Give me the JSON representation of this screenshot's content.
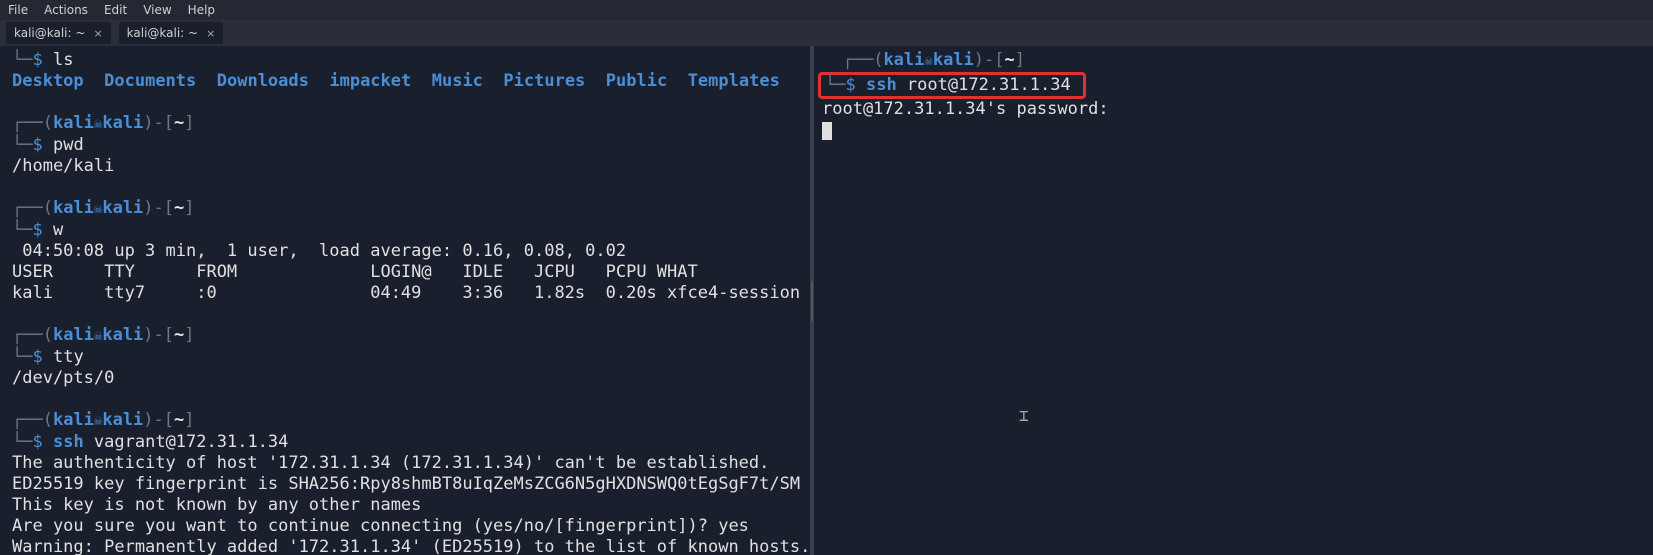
{
  "menubar": {
    "file": "File",
    "actions": "Actions",
    "edit": "Edit",
    "view": "View",
    "help": "Help"
  },
  "tabs": [
    {
      "title": "kali@kali: ~"
    },
    {
      "title": "kali@kali: ~"
    }
  ],
  "prompt": {
    "user": "kali",
    "host": "kali",
    "cwd": "~"
  },
  "left": {
    "cmd1": "ls",
    "ls_output": {
      "d1": "Desktop",
      "d2": "Documents",
      "d3": "Downloads",
      "d4": "impacket",
      "d5": "Music",
      "d6": "Pictures",
      "d7": "Public",
      "d8": "Templates"
    },
    "cmd2": "pwd",
    "pwd_out": "/home/kali",
    "cmd3": "w",
    "w_line1": " 04:50:08 up 3 min,  1 user,  load average: 0.16, 0.08, 0.02",
    "w_line2": "USER     TTY      FROM             LOGIN@   IDLE   JCPU   PCPU WHAT",
    "w_line3": "kali     tty7     :0               04:49    3:36   1.82s  0.20s xfce4-session",
    "cmd4": "tty",
    "tty_out": "/dev/pts/0",
    "cmd5_a": "ssh",
    "cmd5_b": " vagrant@172.31.1.34",
    "ssh_l1": "The authenticity of host '172.31.1.34 (172.31.1.34)' can't be established.",
    "ssh_l2": "ED25519 key fingerprint is SHA256:Rpy8shmBT8uIqZeMsZCG6N5gHXDNSWQ0tEgSgF7t/SM",
    "ssh_l3": "This key is not known by any other names",
    "ssh_l4": "Are you sure you want to continue connecting (yes/no/[fingerprint])? yes",
    "ssh_l5": "Warning: Permanently added '172.31.1.34' (ED25519) to the list of known hosts."
  },
  "right": {
    "cmd1_a": "ssh",
    "cmd1_b": " root@172.31.1.34",
    "out1": "root@172.31.1.34's password: "
  }
}
